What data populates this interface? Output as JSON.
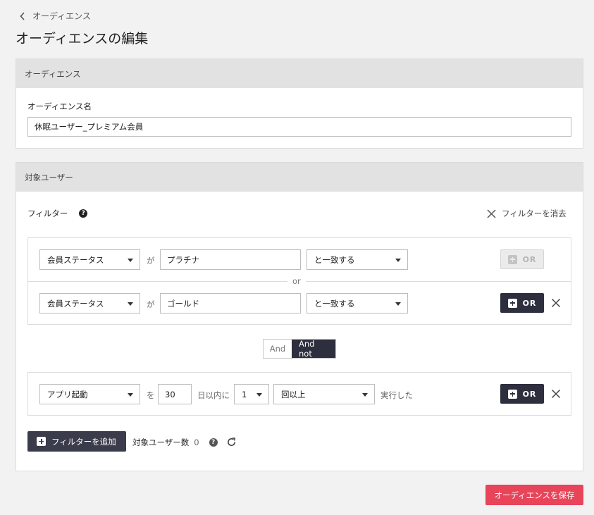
{
  "breadcrumb": {
    "back_label": "オーディエンス"
  },
  "page_title": "オーディエンスの編集",
  "audience_section": {
    "header": "オーディエンス",
    "name_label": "オーディエンス名",
    "name_value": "休眠ユーザー_プレミアム会員"
  },
  "target_section": {
    "header": "対象ユーザー",
    "filter_label": "フィルター",
    "help_icon": "?",
    "clear_label": "フィルターを消去",
    "group1": {
      "rows": [
        {
          "field": "会員ステータス",
          "connector": "が",
          "value": "プラチナ",
          "operator": "と一致する",
          "or_label": "OR",
          "or_enabled": false
        },
        {
          "field": "会員ステータス",
          "connector": "が",
          "value": "ゴールド",
          "operator": "と一致する",
          "or_label": "OR",
          "or_enabled": true
        }
      ],
      "or_separator": "or"
    },
    "logic_toggle": {
      "options": [
        "And",
        "And not"
      ],
      "selected": "And not"
    },
    "group2": {
      "field": "アプリ起動",
      "connector": "を",
      "days": "30",
      "days_suffix": "日以内に",
      "count": "1",
      "count_operator": "回以上",
      "suffix": "実行した",
      "or_label": "OR"
    },
    "add_filter_label": "フィルターを追加",
    "target_count_label": "対象ユーザー数",
    "target_count_value": "0"
  },
  "save_label": "オーディエンスを保存",
  "colors": {
    "accent": "#e8445a",
    "dark": "#2d2f3e",
    "header_bg": "#e2e2e2"
  },
  "icons": [
    "chevron-left-icon",
    "help-icon",
    "close-icon",
    "plus-icon",
    "refresh-icon",
    "caret-down-icon"
  ]
}
